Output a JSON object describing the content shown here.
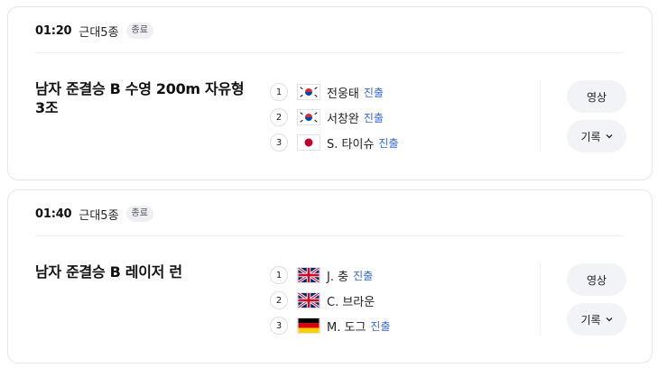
{
  "events": [
    {
      "time": "01:20",
      "sport": "근대5종",
      "status": "종료",
      "title": "남자 준결승 B 수영 200m 자유형 3조",
      "results": [
        {
          "rank": "1",
          "flag": "korea-flag-icon",
          "athlete": "전웅태",
          "advance": "진출"
        },
        {
          "rank": "2",
          "flag": "korea-flag-icon",
          "athlete": "서창완",
          "advance": "진출"
        },
        {
          "rank": "3",
          "flag": "japan-flag-icon",
          "athlete": "S. 타이슈",
          "advance": "진출"
        }
      ],
      "video_label": "영상",
      "record_label": "기록"
    },
    {
      "time": "01:40",
      "sport": "근대5종",
      "status": "종료",
      "title": "남자 준결승 B 레이저 런",
      "results": [
        {
          "rank": "1",
          "flag": "uk-flag-icon",
          "athlete": "J. 충",
          "advance": "진출"
        },
        {
          "rank": "2",
          "flag": "uk-flag-icon",
          "athlete": "C. 브라운",
          "advance": ""
        },
        {
          "rank": "3",
          "flag": "germany-flag-icon",
          "athlete": "M. 도그",
          "advance": "진출"
        }
      ],
      "video_label": "영상",
      "record_label": "기록"
    }
  ],
  "colors": {
    "advance": "#3c6bd0",
    "button_bg": "#f1f3f6",
    "badge_bg": "#eef0f3"
  }
}
